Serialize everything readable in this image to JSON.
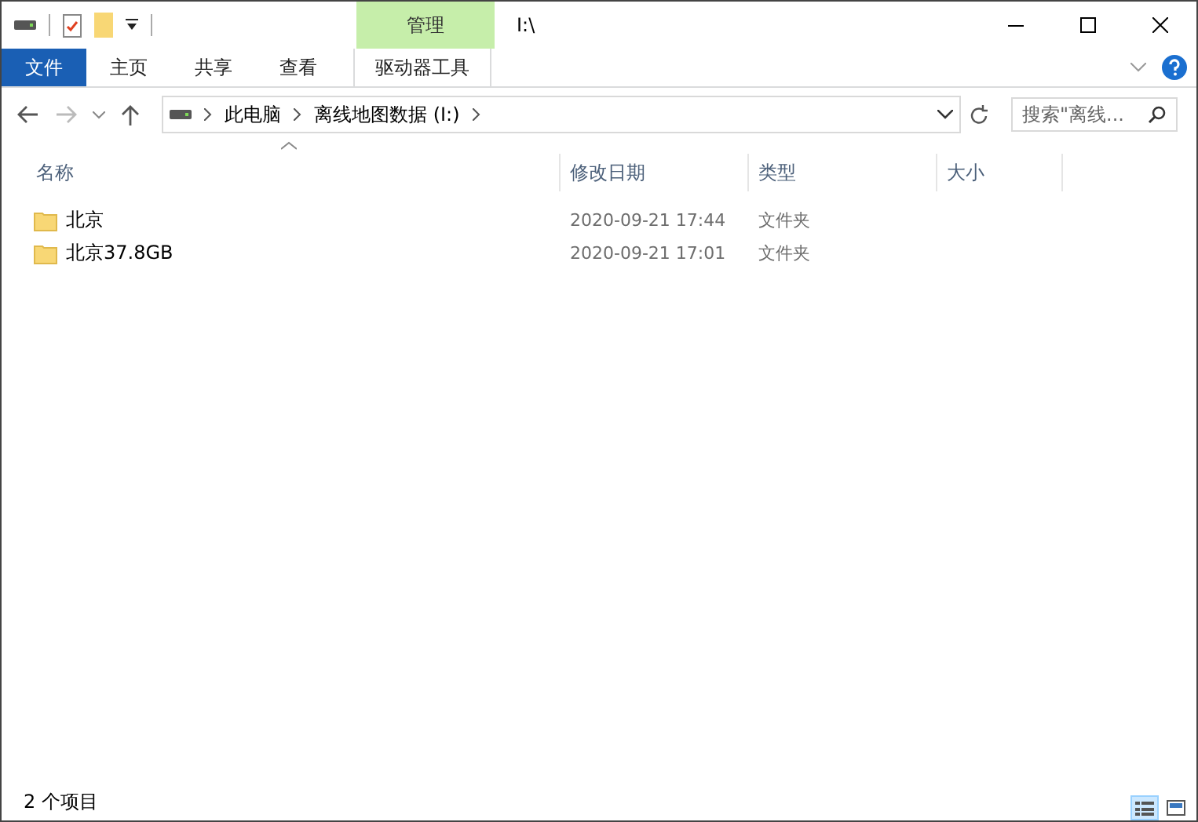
{
  "window": {
    "title": "I:\\"
  },
  "ribbon": {
    "context_group": "管理",
    "tabs": [
      {
        "label": "文件",
        "kind": "file",
        "selected": false
      },
      {
        "label": "主页",
        "kind": "plain",
        "selected": false
      },
      {
        "label": "共享",
        "kind": "plain",
        "selected": false
      },
      {
        "label": "查看",
        "kind": "plain",
        "selected": false
      },
      {
        "label": "驱动器工具",
        "kind": "context",
        "selected": false
      }
    ]
  },
  "address": {
    "crumbs": [
      "此电脑",
      "离线地图数据 (I:)"
    ]
  },
  "search": {
    "placeholder": "搜索\"离线..."
  },
  "table": {
    "columns": [
      "名称",
      "修改日期",
      "类型",
      "大小"
    ],
    "rows": [
      {
        "name": "北京",
        "modified": "2020-09-21 17:44",
        "type": "文件夹",
        "selected": false
      },
      {
        "name": "北京37.8GB",
        "modified": "2020-09-21 17:01",
        "type": "文件夹",
        "selected": false
      }
    ]
  },
  "status_bar": {
    "count": "2 个项目"
  },
  "view_buttons": [
    {
      "kind": "details",
      "selected": true
    },
    {
      "kind": "large_icons",
      "selected": false
    }
  ]
}
